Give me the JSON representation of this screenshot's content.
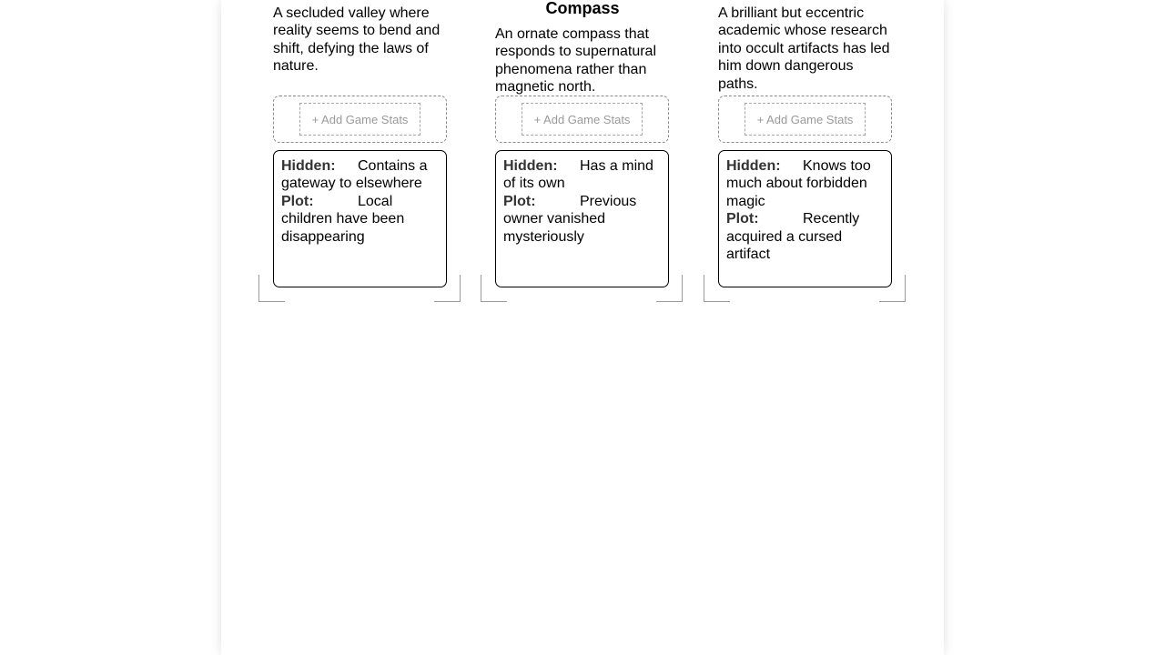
{
  "cards": [
    {
      "title": "",
      "description": "A secluded valley where reality seems to bend and shift, defying the laws of nature.",
      "add_stats_label": "+ Add Game Stats",
      "hidden_label": "Hidden:",
      "hidden_value": "Contains a gateway to elsewhere",
      "plot_label": "Plot:",
      "plot_value": "Local children have been disappearing"
    },
    {
      "title": "Compass",
      "description": "An ornate compass that responds to supernatural phenomena rather than magnetic north.",
      "add_stats_label": "+ Add Game Stats",
      "hidden_label": "Hidden:",
      "hidden_value": "Has a mind of its own",
      "plot_label": "Plot:",
      "plot_value": "Previous owner vanished mysteriously"
    },
    {
      "title": "",
      "description": "A brilliant but eccentric academic whose research into occult artifacts has led him down dangerous paths.",
      "add_stats_label": "+ Add Game Stats",
      "hidden_label": "Hidden:",
      "hidden_value": "Knows too much about forbidden magic",
      "plot_label": "Plot:",
      "plot_value": "Recently acquired a cursed artifact"
    }
  ]
}
